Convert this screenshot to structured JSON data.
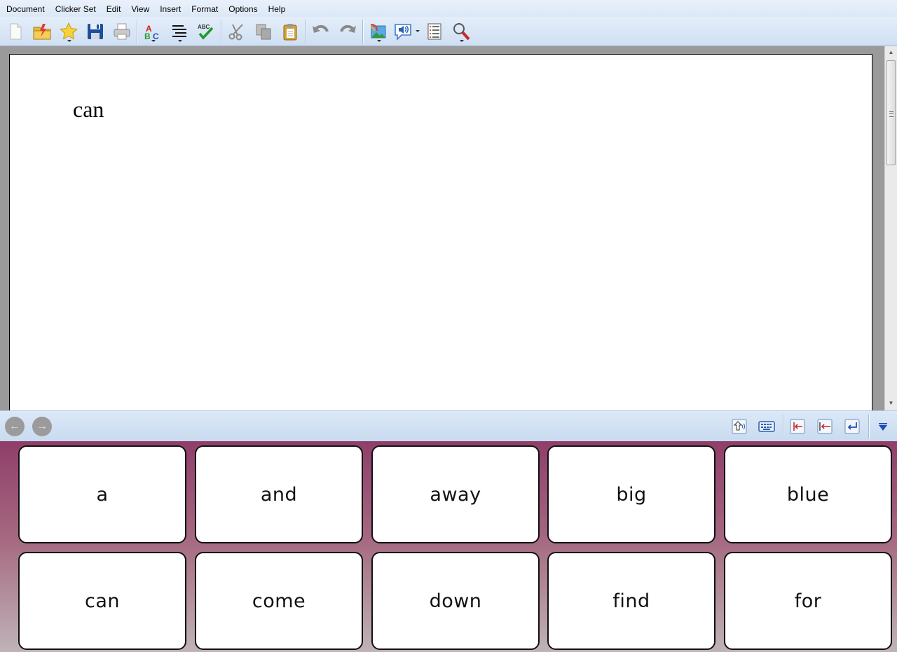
{
  "menu": [
    "Document",
    "Clicker Set",
    "Edit",
    "View",
    "Insert",
    "Format",
    "Options",
    "Help"
  ],
  "toolbar": {
    "icons": [
      "new-document-icon",
      "open-icon",
      "favourites-icon",
      "save-icon",
      "print-icon",
      "spellcheck-icon",
      "align-icon",
      "spell-check-icon",
      "cut-icon",
      "copy-icon",
      "paste-icon",
      "undo-icon",
      "redo-icon",
      "insert-picture-icon",
      "speech-icon",
      "word-list-icon",
      "zoom-icon"
    ]
  },
  "document": {
    "text": "can"
  },
  "nav": {
    "back": "←",
    "forward": "→",
    "tools": [
      "speak-cell-icon",
      "keyboard-icon",
      "tab-icon",
      "backspace-icon",
      "enter-icon",
      "collapse-icon"
    ]
  },
  "grid": {
    "cells": [
      "a",
      "and",
      "away",
      "big",
      "blue",
      "can",
      "come",
      "down",
      "find",
      "for"
    ]
  },
  "colors": {
    "grid_top": "#8f3e6a",
    "grid_bottom": "#bfb3b8",
    "toolbar": "#dce8f7"
  }
}
